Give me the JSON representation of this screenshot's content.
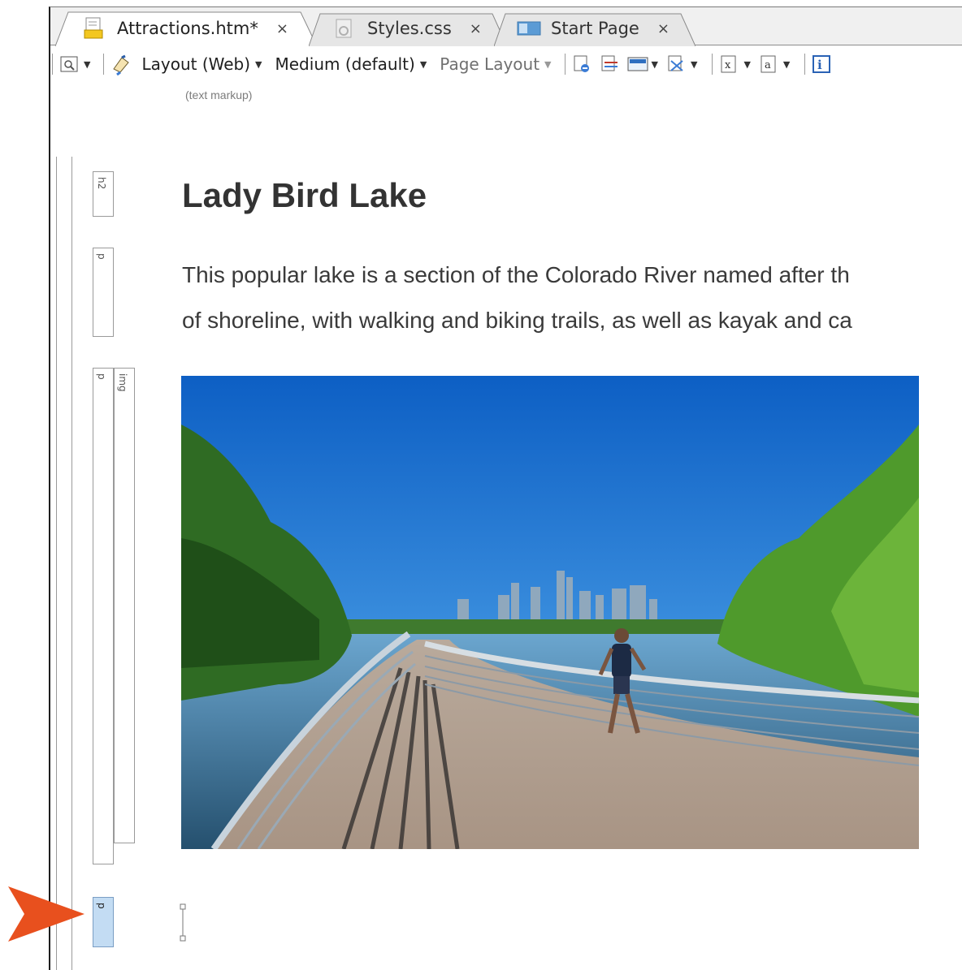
{
  "tabs": [
    {
      "label": "Attractions.htm*",
      "close": "×",
      "active": true,
      "icon": "html-file-icon"
    },
    {
      "label": "Styles.css",
      "close": "×",
      "active": false,
      "icon": "css-file-icon"
    },
    {
      "label": "Start Page",
      "close": "×",
      "active": false,
      "icon": "start-page-icon"
    }
  ],
  "toolbar": {
    "layout": "Layout (Web)",
    "medium": "Medium (default)",
    "page_layout": "Page Layout"
  },
  "markup_label": "(text markup)",
  "structure_bars": {
    "h2": "h2",
    "p1": "p",
    "p2": "p",
    "img": "img",
    "p3": "p"
  },
  "content": {
    "heading": "Lady Bird Lake",
    "paragraph_line1": "This popular lake is a section of the Colorado River named after th",
    "paragraph_line2": "of shoreline, with walking and biking trails, as well as kayak and ca"
  },
  "colors": {
    "selected_bar": "#c3dcf3",
    "pointer": "#e8501e",
    "heading_text": "#333333"
  }
}
